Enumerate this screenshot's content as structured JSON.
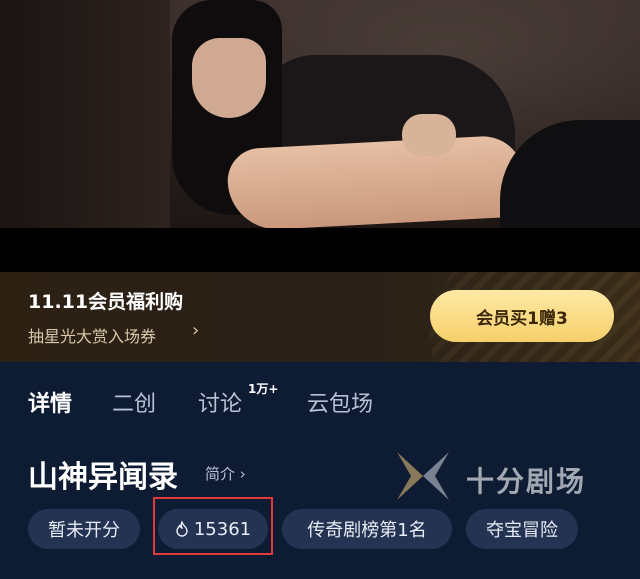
{
  "promo": {
    "title": "11.11会员福利购",
    "subtitle": "抽星光大赏入场券",
    "subtitle_arrow": "›",
    "button_label": "会员买1赠3"
  },
  "tabs": [
    {
      "label": "详情",
      "active": true
    },
    {
      "label": "二创",
      "active": false
    },
    {
      "label": "讨论",
      "active": false,
      "badge": "1万+"
    },
    {
      "label": "云包场",
      "active": false
    }
  ],
  "show": {
    "title": "山神异闻录",
    "intro_label": "简介 ›"
  },
  "chips": [
    {
      "label": "暂未开分"
    },
    {
      "label": "15361",
      "icon": "flame-icon"
    },
    {
      "label": "传奇剧榜第1名"
    },
    {
      "label": "夺宝冒险"
    }
  ],
  "watermark": {
    "text": "十分剧场"
  },
  "colors": {
    "page_bg": "#0d1b33",
    "chip_bg": "#243352",
    "gold_button": "#f6cf6a",
    "highlight": "#e23a3a"
  }
}
